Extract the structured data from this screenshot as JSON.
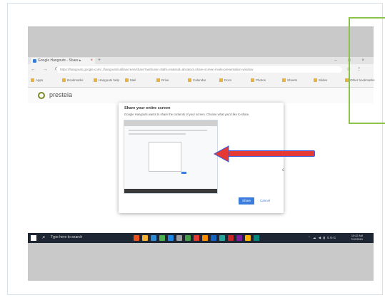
{
  "browser": {
    "tab_title": "Google Hangouts - Share ▸",
    "new_tab_glyph": "+",
    "window_controls": "– □ ×",
    "nav_glyphs": "← → ⟳",
    "url": "https://hangouts.google.com/_/hangouts/call/ascreen/share?authuser=0&hl=en&ssid=abc&cid=share-screen-invite-presentation-window",
    "extension_glyphs": "☆ ⋮",
    "bookmarks": [
      "Apps",
      "Bookmarks",
      "Hangouts help",
      "Mail",
      "Drive",
      "Calendar",
      "Docs",
      "Photos",
      "Sheets",
      "Slides",
      "Other bookmarks"
    ]
  },
  "app": {
    "logo_text": "presteia"
  },
  "dialog": {
    "title": "Share your entire screen",
    "subtitle": "Google Hangouts wants to share the contents of your screen. Choose what you'd like to share.",
    "share_label": "Share",
    "cancel_label": "Cancel"
  },
  "stray_text": "c",
  "taskbar": {
    "search_glyph": "⌕",
    "search_text": "Type here to search",
    "tray_text": "⌃ ☁ ◀ ▮ ENG",
    "clock_time": "10:42 AM",
    "clock_date": "7/12/2019",
    "app_colors": [
      "#e8541d",
      "#f2b233",
      "#2f8bd6",
      "#4caf50",
      "#1e88e5",
      "#9e9e9e",
      "#43a047",
      "#e53935",
      "#fb8c00",
      "#1565c0",
      "#26a69a",
      "#c62828",
      "#7b1fa2",
      "#ffb300",
      "#00897b"
    ]
  },
  "colors": {
    "annotation_green": "#8bc34a",
    "annotation_red": "#e53935",
    "arrow_outline": "#3b5bdb",
    "accent_blue": "#3b7ddd"
  }
}
